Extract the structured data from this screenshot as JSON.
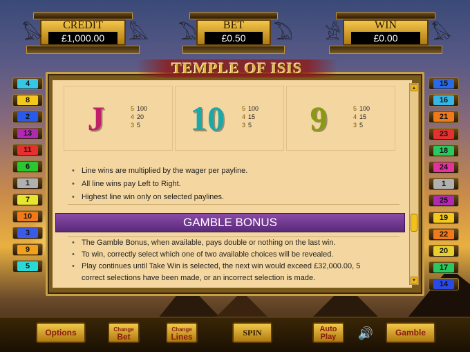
{
  "header": {
    "credit": {
      "label": "CREDIT",
      "value": "£1,000.00"
    },
    "bet": {
      "label": "BET",
      "value": "£0.50"
    },
    "win": {
      "label": "WIN",
      "value": "£0.00"
    }
  },
  "title": "TEMPLE OF ISIS",
  "paylines_left": [
    {
      "num": "4",
      "color": "#36c6e6"
    },
    {
      "num": "8",
      "color": "#f2c81c"
    },
    {
      "num": "2",
      "color": "#2a5ae8"
    },
    {
      "num": "13",
      "color": "#b02ab0"
    },
    {
      "num": "11",
      "color": "#e63030"
    },
    {
      "num": "6",
      "color": "#2ac830"
    },
    {
      "num": "1",
      "color": "#b0b0b0"
    },
    {
      "num": "7",
      "color": "#e6e630"
    },
    {
      "num": "10",
      "color": "#f07a1a"
    },
    {
      "num": "3",
      "color": "#3a5ae8"
    },
    {
      "num": "9",
      "color": "#f0a01a"
    },
    {
      "num": "5",
      "color": "#2ad8d8"
    }
  ],
  "paylines_right": [
    {
      "num": "15",
      "color": "#2a6ae8"
    },
    {
      "num": "16",
      "color": "#36b6e6"
    },
    {
      "num": "21",
      "color": "#f07a1a"
    },
    {
      "num": "23",
      "color": "#e63030"
    },
    {
      "num": "18",
      "color": "#2ac860"
    },
    {
      "num": "24",
      "color": "#e630a0"
    },
    {
      "num": "1",
      "color": "#b0b0b0"
    },
    {
      "num": "25",
      "color": "#b02ab0"
    },
    {
      "num": "19",
      "color": "#f2c81c"
    },
    {
      "num": "22",
      "color": "#f07a1a"
    },
    {
      "num": "20",
      "color": "#e6d030"
    },
    {
      "num": "17",
      "color": "#2ac860"
    },
    {
      "num": "14",
      "color": "#2a4ae8"
    }
  ],
  "symbols": [
    {
      "glyph": "J",
      "color": "#c0206a",
      "pays": [
        {
          "k": "5",
          "v": "100"
        },
        {
          "k": "4",
          "v": "20"
        },
        {
          "k": "3",
          "v": "5"
        }
      ]
    },
    {
      "glyph": "10",
      "color": "#1aa8a8",
      "pays": [
        {
          "k": "5",
          "v": "100"
        },
        {
          "k": "4",
          "v": "15"
        },
        {
          "k": "3",
          "v": "5"
        }
      ]
    },
    {
      "glyph": "9",
      "color": "#8a9a10",
      "pays": [
        {
          "k": "5",
          "v": "100"
        },
        {
          "k": "4",
          "v": "15"
        },
        {
          "k": "3",
          "v": "5"
        }
      ]
    }
  ],
  "line_rules": [
    "Line wins are multiplied by the wager per payline.",
    "All line wins pay Left to Right.",
    "Highest line win only on selected paylines."
  ],
  "gamble": {
    "heading": "GAMBLE BONUS",
    "rules": [
      "The Gamble Bonus, when available, pays double or nothing on the last win.",
      "To win, correctly select which one of two available choices will be revealed.",
      "Play continues until Take Win is selected, the next win would exceed £32,000.00, 5",
      "correct selections have been made, or an incorrect selection is made."
    ]
  },
  "buttons": {
    "options": "Options",
    "change_bet_1": "Change",
    "change_bet_2": "Bet",
    "change_lines_1": "Change",
    "change_lines_2": "Lines",
    "spin": "SPIN",
    "autoplay_1": "Auto",
    "autoplay_2": "Play",
    "gamble": "Gamble"
  }
}
